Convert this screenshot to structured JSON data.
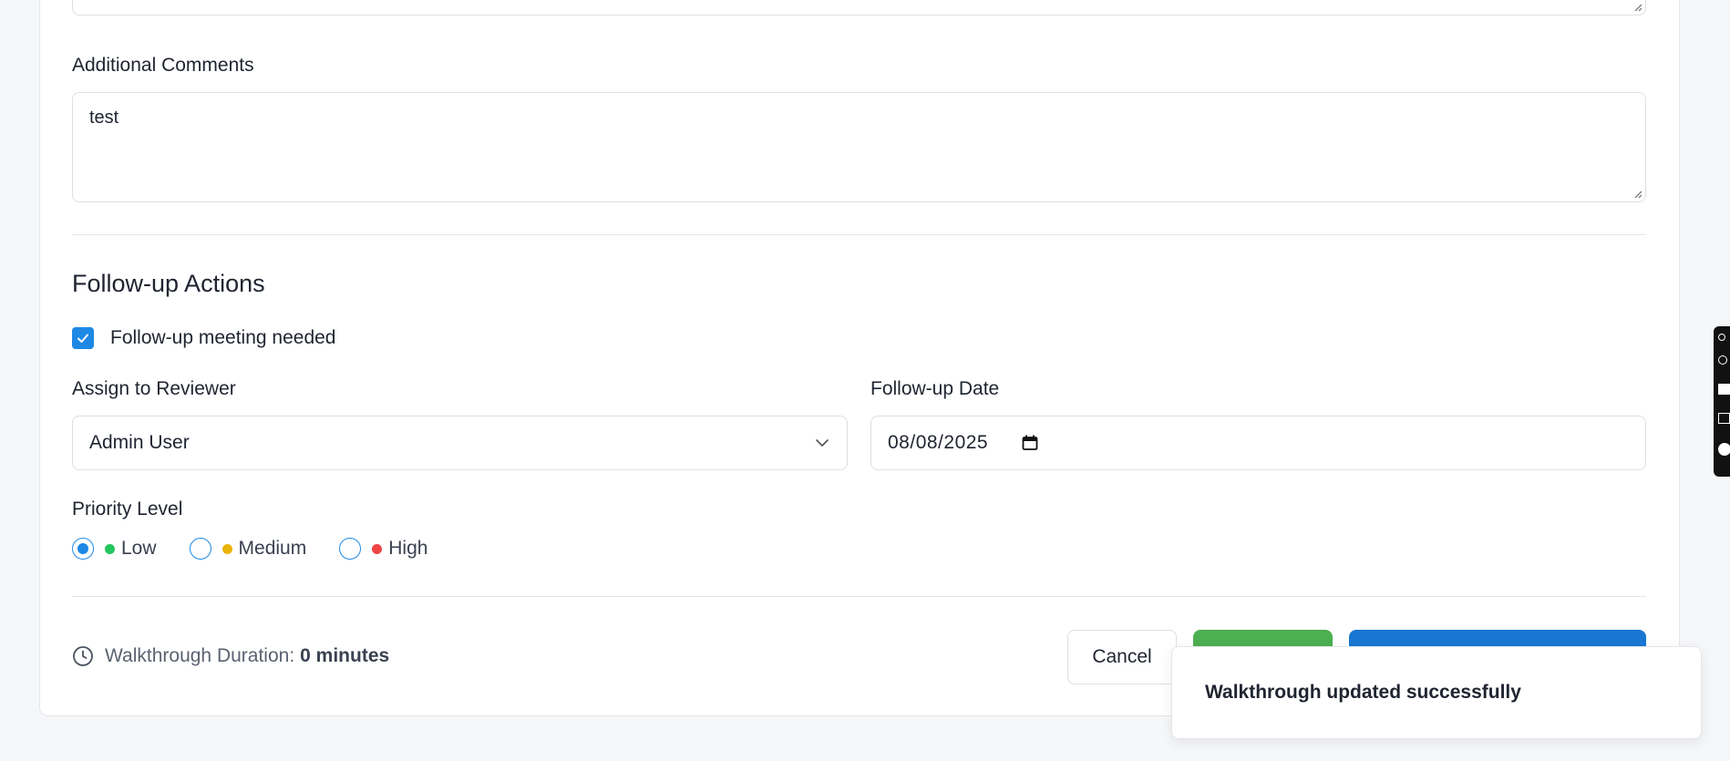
{
  "comments": {
    "label": "Additional Comments",
    "value": "test"
  },
  "followup": {
    "section_title": "Follow-up Actions",
    "meeting_needed_label": "Follow-up meeting needed",
    "meeting_needed_checked": true,
    "reviewer_label": "Assign to Reviewer",
    "reviewer_value": "Admin User",
    "date_label": "Follow-up Date",
    "date_value": "08/08/2025",
    "priority_label": "Priority Level",
    "priority_options": [
      {
        "label": "Low",
        "color": "#22c55e",
        "selected": true
      },
      {
        "label": "Medium",
        "color": "#eab308",
        "selected": false
      },
      {
        "label": "High",
        "color": "#ef4444",
        "selected": false
      }
    ]
  },
  "footer": {
    "duration_label": "Walkthrough Duration:",
    "duration_value": "0 minutes",
    "cancel_label": "Cancel"
  },
  "toast": {
    "message": "Walkthrough updated successfully"
  },
  "colors": {
    "accent": "#1e88e5",
    "green_button": "#4caf50",
    "blue_button": "#1976d2"
  }
}
